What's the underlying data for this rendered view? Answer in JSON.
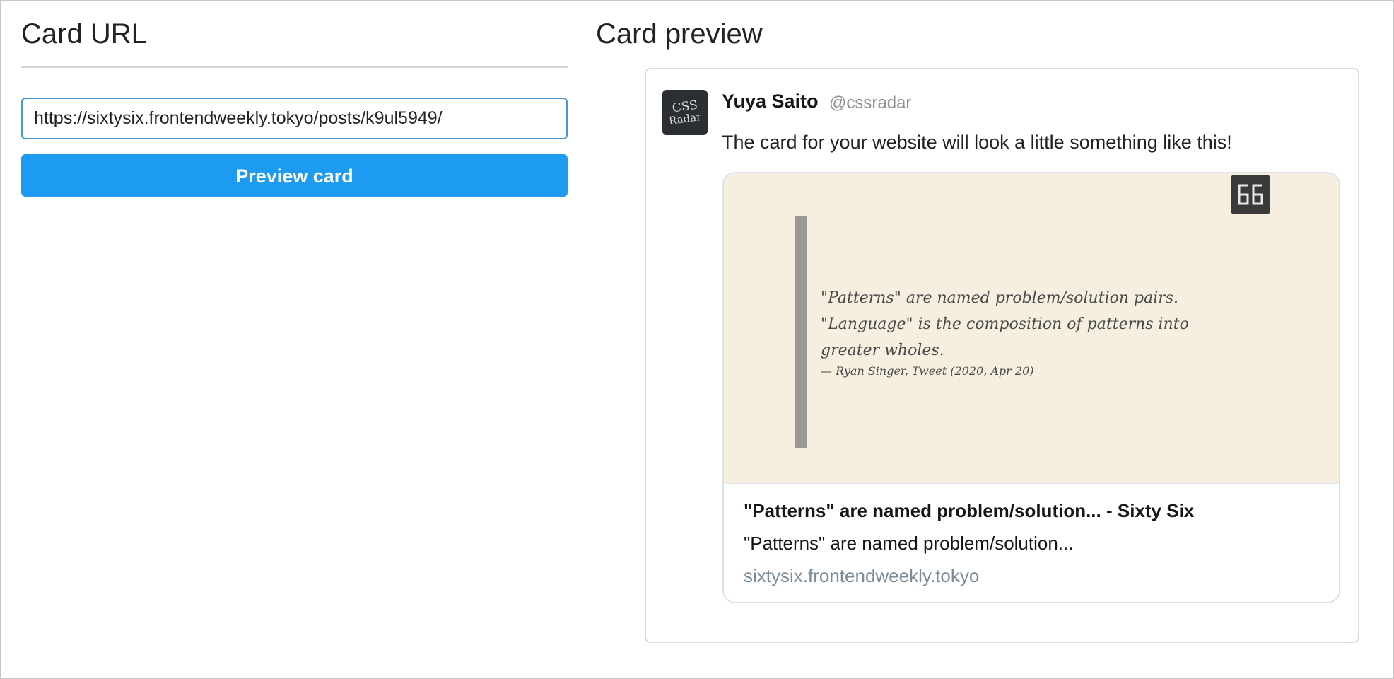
{
  "url_panel": {
    "title": "Card URL",
    "url_value": "https://sixtysix.frontendweekly.tokyo/posts/k9ul5949/",
    "button_label": "Preview card"
  },
  "preview_panel": {
    "title": "Card preview",
    "tweet": {
      "avatar_line1": "CSS",
      "avatar_line2": "Radar",
      "author_name": "Yuya Saito",
      "author_handle": "@cssradar",
      "text": "The card for your website will look a little something like this!"
    },
    "card": {
      "quote_line1": "\"Patterns\" are named problem/solution pairs.",
      "quote_line2": "\"Language\" is the composition of patterns into",
      "quote_line3": "greater wholes.",
      "cite_prefix": "— ",
      "cite_author": "Ryan Singer",
      "cite_suffix": ", Tweet (2020, Apr 20)",
      "title": "\"Patterns\" are named problem/solution... - Sixty Six",
      "description": "\"Patterns\" are named problem/solution...",
      "domain": "sixtysix.frontendweekly.tokyo"
    }
  },
  "colors": {
    "button": "#1d9bf0",
    "input_border": "#4a98d8",
    "card_image_bg": "#f6eedf",
    "domain_text": "#7b8b98"
  },
  "icons": {
    "site_logo": "sixty-six-logo-icon",
    "avatar": "css-radar-avatar"
  }
}
